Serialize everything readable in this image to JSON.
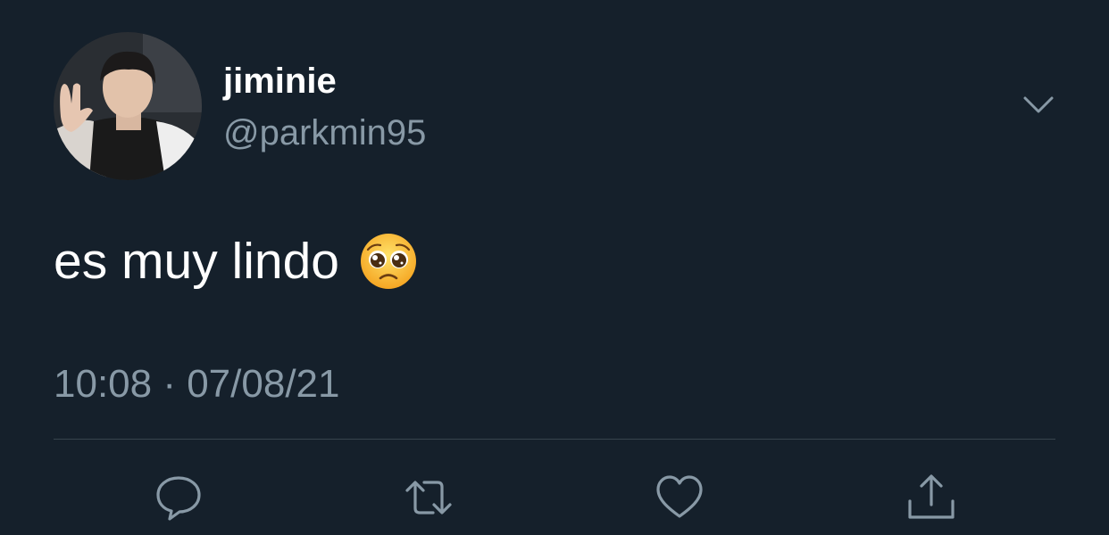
{
  "tweet": {
    "display_name": "jiminie",
    "handle": "@parkmin95",
    "text": "es muy lindo",
    "emoji_icon": "pleading-face-emoji",
    "timestamp": "10:08 · 07/08/21"
  },
  "icons": {
    "menu": "chevron-down-icon",
    "reply": "reply-icon",
    "retweet": "retweet-icon",
    "like": "heart-icon",
    "share": "share-icon"
  },
  "colors": {
    "background": "#15202b",
    "primary_text": "#ffffff",
    "secondary_text": "#8899a6",
    "divider": "#38444d"
  }
}
